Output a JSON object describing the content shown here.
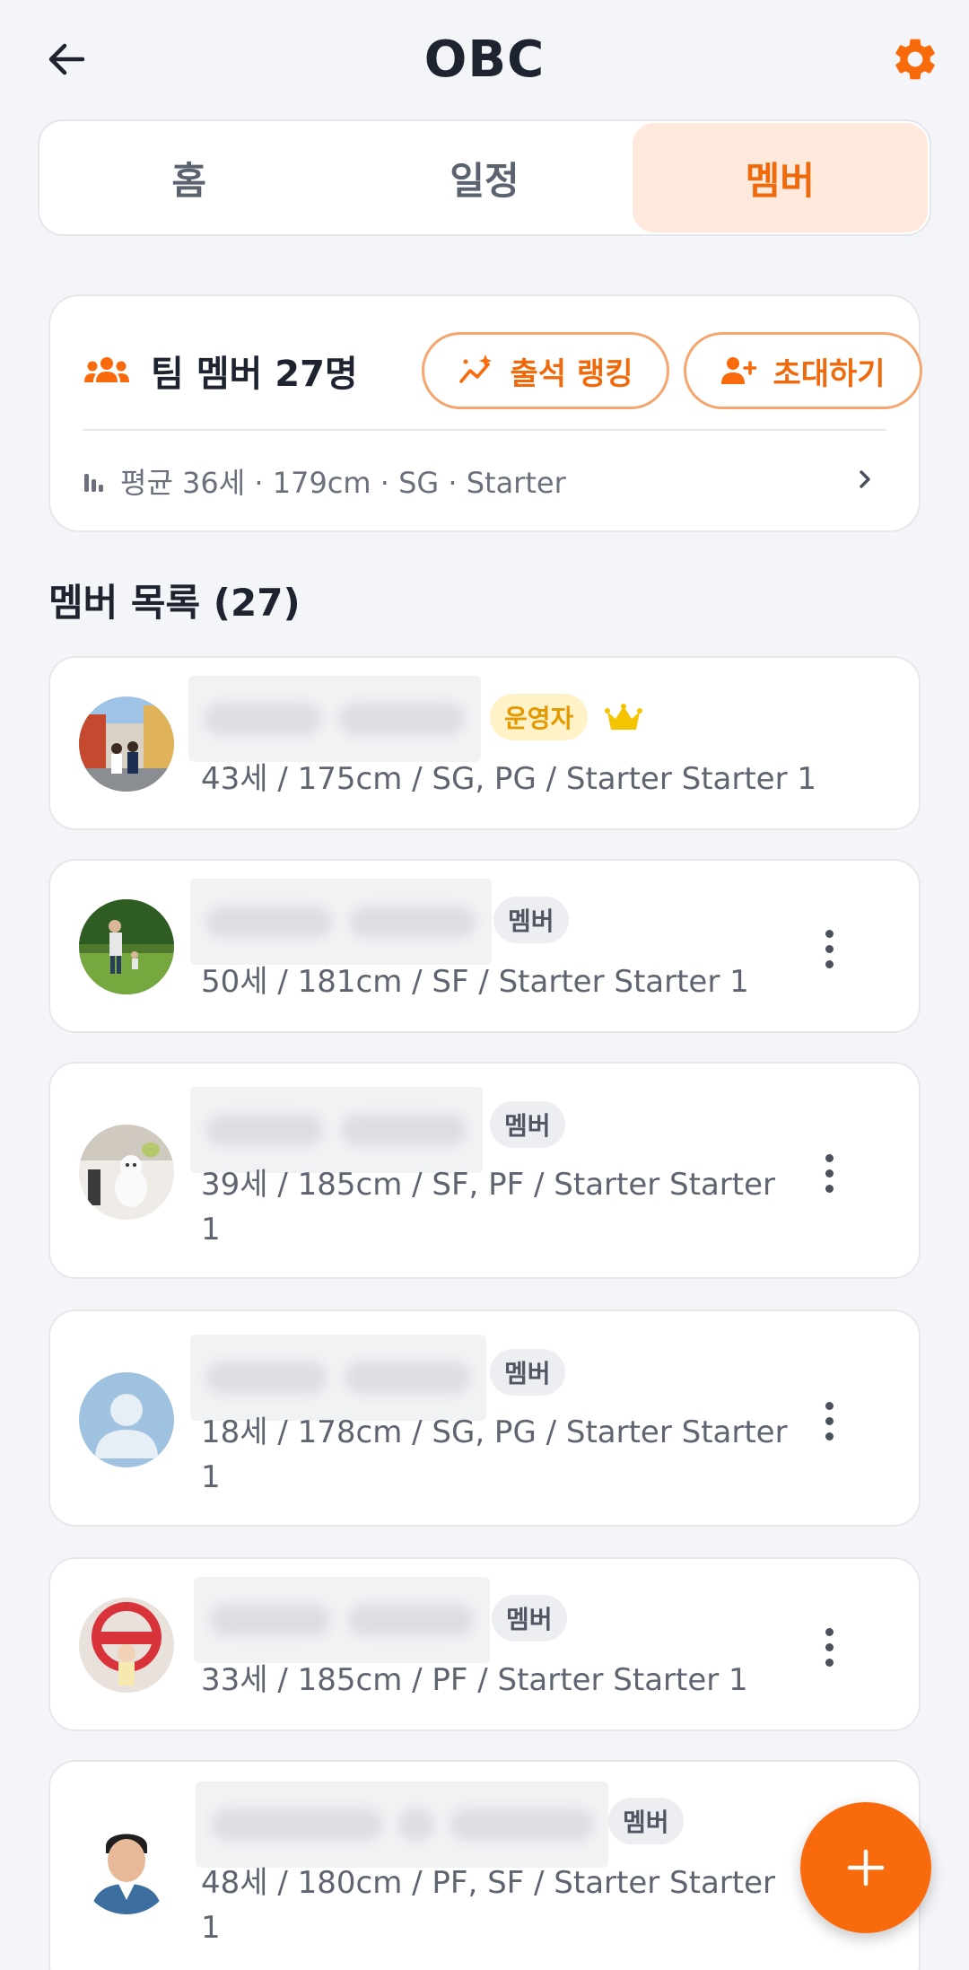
{
  "header": {
    "title": "OBC"
  },
  "tabs": [
    {
      "label": "홈",
      "active": false
    },
    {
      "label": "일정",
      "active": false
    },
    {
      "label": "멤버",
      "active": true
    }
  ],
  "team": {
    "title": "팀 멤버 27명",
    "ranking_button": "출석 랭킹",
    "invite_button": "초대하기",
    "stats": "평균 36세 · 179cm · SG · Starter"
  },
  "member_list": {
    "title": "멤버 목록 (27)",
    "members": [
      {
        "role": "운영자",
        "info": "43세 / 175cm / SG, PG / Starter Starter 1"
      },
      {
        "role": "멤버",
        "info": "50세 / 181cm / SF / Starter Starter 1"
      },
      {
        "role": "멤버",
        "info": "39세 / 185cm / SF, PF / Starter Starter 1"
      },
      {
        "role": "멤버",
        "info": "18세 / 178cm / SG, PG / Starter Starter 1"
      },
      {
        "role": "멤버",
        "info": "33세 / 185cm / PF / Starter Starter 1"
      },
      {
        "role": "멤버",
        "info": "48세 / 180cm / PF, SF / Starter Starter 1"
      }
    ]
  },
  "colors": {
    "accent": "#f96a0c",
    "tab_active_bg": "#ffe9dc",
    "admin_badge": "#fff2c9"
  },
  "icons": [
    "back-arrow-icon",
    "gear-icon",
    "people-icon",
    "trend-sparkle-icon",
    "person-add-icon",
    "bar-chart-icon",
    "chevron-right-icon",
    "crown-icon",
    "more-vertical-icon",
    "plus-icon"
  ]
}
